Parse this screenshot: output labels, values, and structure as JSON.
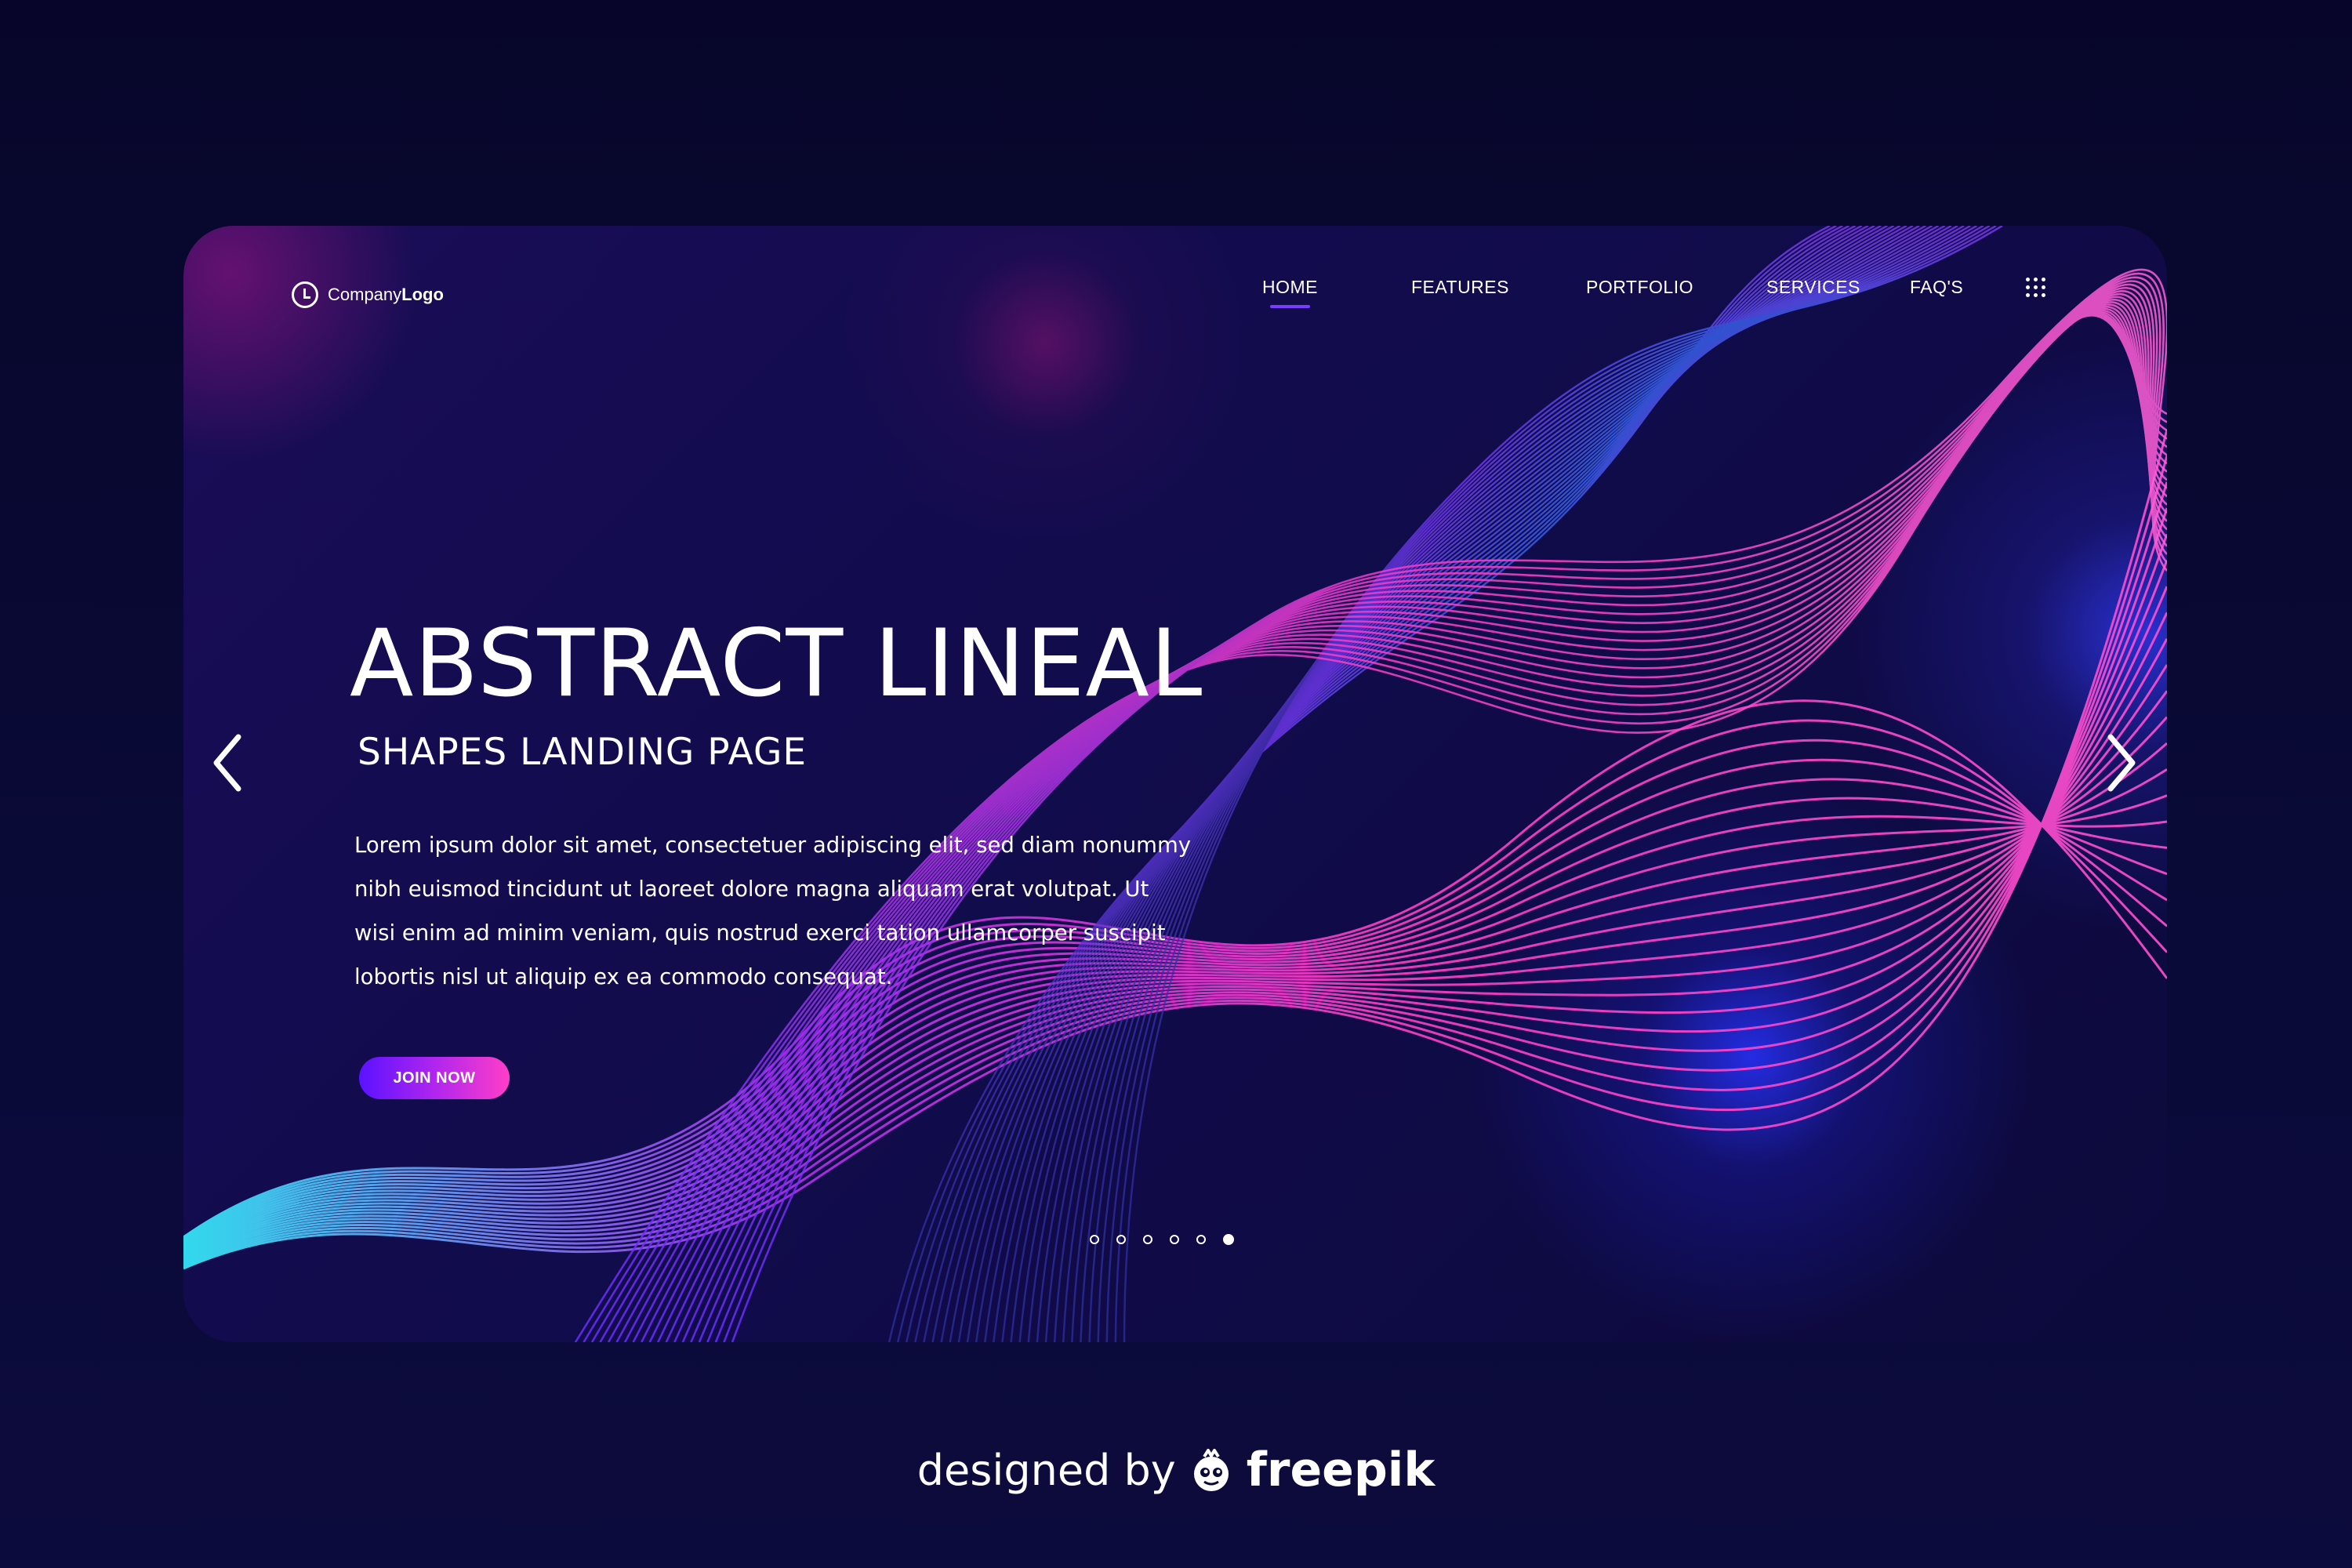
{
  "logo": {
    "text_regular": "Company",
    "text_bold": "Logo"
  },
  "nav": {
    "items": [
      {
        "label": "HOME",
        "active": true
      },
      {
        "label": "FEATURES",
        "active": false
      },
      {
        "label": "PORTFOLIO",
        "active": false
      },
      {
        "label": "SERVICES",
        "active": false
      },
      {
        "label": "FAQ'S",
        "active": false
      }
    ],
    "menu_icon": "grid-dots-icon"
  },
  "hero": {
    "title": "ABSTRACT LINEAL",
    "subtitle": "SHAPES LANDING PAGE",
    "body_lines": [
      "Lorem ipsum dolor sit amet, consectetuer adipiscing elit, sed diam nonummy",
      "nibh euismod tincidunt ut laoreet dolore magna aliquam erat volutpat. Ut",
      "wisi enim ad minim veniam, quis nostrud exerci tation ullamcorper suscipit",
      "lobortis nisl ut aliquip ex ea commodo consequat."
    ],
    "cta_label": "JOIN NOW"
  },
  "slider": {
    "prev_icon": "chevron-left-icon",
    "next_icon": "chevron-right-icon",
    "total_slides": 6,
    "active_slide": 6
  },
  "credit": {
    "prefix": "designed by",
    "brand": "freepik"
  },
  "colors": {
    "page_background": "#07062a",
    "card_background": "#120c4e",
    "accent_magenta": "#ff3ec8",
    "accent_violet": "#7a3cff",
    "accent_cyan": "#35f0ff",
    "accent_blue": "#2f3dff"
  }
}
